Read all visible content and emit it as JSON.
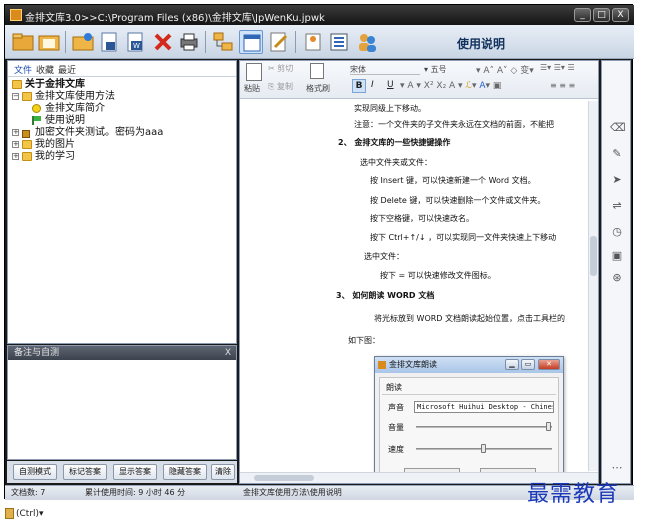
{
  "window": {
    "title": "金排文库3.0>>C:\\Program Files (x86)\\金排文库\\JpWenKu.jpwk",
    "controls": [
      "_",
      "□",
      "X"
    ]
  },
  "toolbar": {
    "icons": [
      "open-folder-icon",
      "folder-icon",
      "folder-star-icon",
      "new-doc-icon",
      "save-doc-icon",
      "delete-icon",
      "print-icon",
      "tree-view-icon",
      "single-view-icon",
      "edit-icon",
      "doc-icon",
      "list-icon",
      "users-icon"
    ],
    "help_label": "使用说明"
  },
  "left_panel": {
    "tabs": [
      "文件",
      "收藏",
      "最近"
    ],
    "tree": [
      {
        "label": "关于金排文库",
        "level": 0,
        "bold": true,
        "icon": "folder-icon",
        "expander": ""
      },
      {
        "label": "金排文库使用方法",
        "level": 1,
        "bold": false,
        "icon": "folder-icon",
        "expander": "−"
      },
      {
        "label": "金排文库简介",
        "level": 2,
        "bold": false,
        "icon": "smiley-icon",
        "expander": ""
      },
      {
        "label": "使用说明",
        "level": 2,
        "bold": false,
        "icon": "flag-icon",
        "expander": ""
      },
      {
        "label": "加密文件夹测试。密码为aaa",
        "level": 1,
        "bold": false,
        "icon": "lock-icon",
        "expander": "+"
      },
      {
        "label": "我的图片",
        "level": 1,
        "bold": false,
        "icon": "folder-icon",
        "expander": "+"
      },
      {
        "label": "我的学习",
        "level": 1,
        "bold": false,
        "icon": "folder-icon",
        "expander": "+"
      }
    ]
  },
  "notes": {
    "title": "备注与自测",
    "close": "X"
  },
  "bottom_buttons": [
    "自测模式",
    "标记答案",
    "显示答案",
    "隐藏答案",
    "清除"
  ],
  "ribbon": {
    "paste": "粘贴",
    "cut": "剪切",
    "copy": "复制",
    "format_painter": "格式刷",
    "font": "宋体",
    "size": "五号",
    "bold": "B",
    "italic": "I",
    "underline": "U"
  },
  "document": {
    "lines": [
      "实现同级上下移动。",
      "注意：一个文件夹的子文件夹永远在文档的前面，不能把",
      "2、  金排文库的一些快捷键操作",
      "选中文件夹或文件：",
      "按 Insert 键，可以快速新建一个 Word 文档。",
      "按 Delete 键，可以快速删除一个文件或文件夹。",
      "按下空格键，可以快速改名。",
      "按下 Ctrl+↑/↓ ，可以实现同一文件夹快速上下移动",
      "选中文件：",
      "按下 = 可以快速修改文件图标。",
      "3、  如何朗读 WORD 文档",
      "将光标放到 WORD 文档朗读起始位置，点击工具栏的",
      "如下图："
    ]
  },
  "dialog": {
    "title": "金排文库朗读",
    "section": "朗读",
    "voice_label": "声音",
    "voice_value": "Microsoft Huihui Desktop - Chinese",
    "volume_label": "音量",
    "speed_label": "速度",
    "volume_level": 1.0,
    "speed_level": 0.5
  },
  "statusbar": {
    "doc_count": "文档数: 7",
    "usage_time": "累计使用时间: 9 小时 46 分",
    "path": "金排文库使用方法\\使用说明"
  },
  "watermark": "最需教育",
  "paste_chip": "(Ctrl)"
}
